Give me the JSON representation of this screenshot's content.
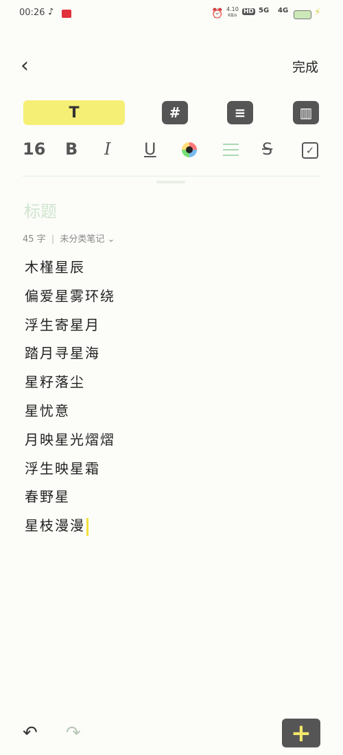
{
  "status_bar": {
    "time": "00:26",
    "net_speed_top": "4.10",
    "net_speed_bottom": "KB/s",
    "hd": "HD",
    "sim_1": "5G",
    "sim_2": "4G"
  },
  "header": {
    "back_icon": "chevron-left-icon",
    "done_label": "完成"
  },
  "mode_tabs": {
    "text_label": "T",
    "hashtag_label": "#",
    "list_label": "≡",
    "layout_label": "▥"
  },
  "format_toolbar": {
    "font_size": "16",
    "bold": "B",
    "italic": "I",
    "underline": "U",
    "strike": "S"
  },
  "note": {
    "title_placeholder": "标题",
    "char_count": "45 字",
    "category": "未分类笔记",
    "lines": [
      "木槿星辰",
      "偏爱星雾环绕",
      "浮生寄星月",
      "踏月寻星海",
      "星籽落尘",
      "星忧意",
      "月映星光熠熠",
      "浮生映星霜",
      "春野星",
      "星枝漫漫"
    ]
  },
  "bottom_bar": {
    "undo_icon": "undo-icon",
    "redo_icon": "redo-icon",
    "add_label": "+"
  }
}
